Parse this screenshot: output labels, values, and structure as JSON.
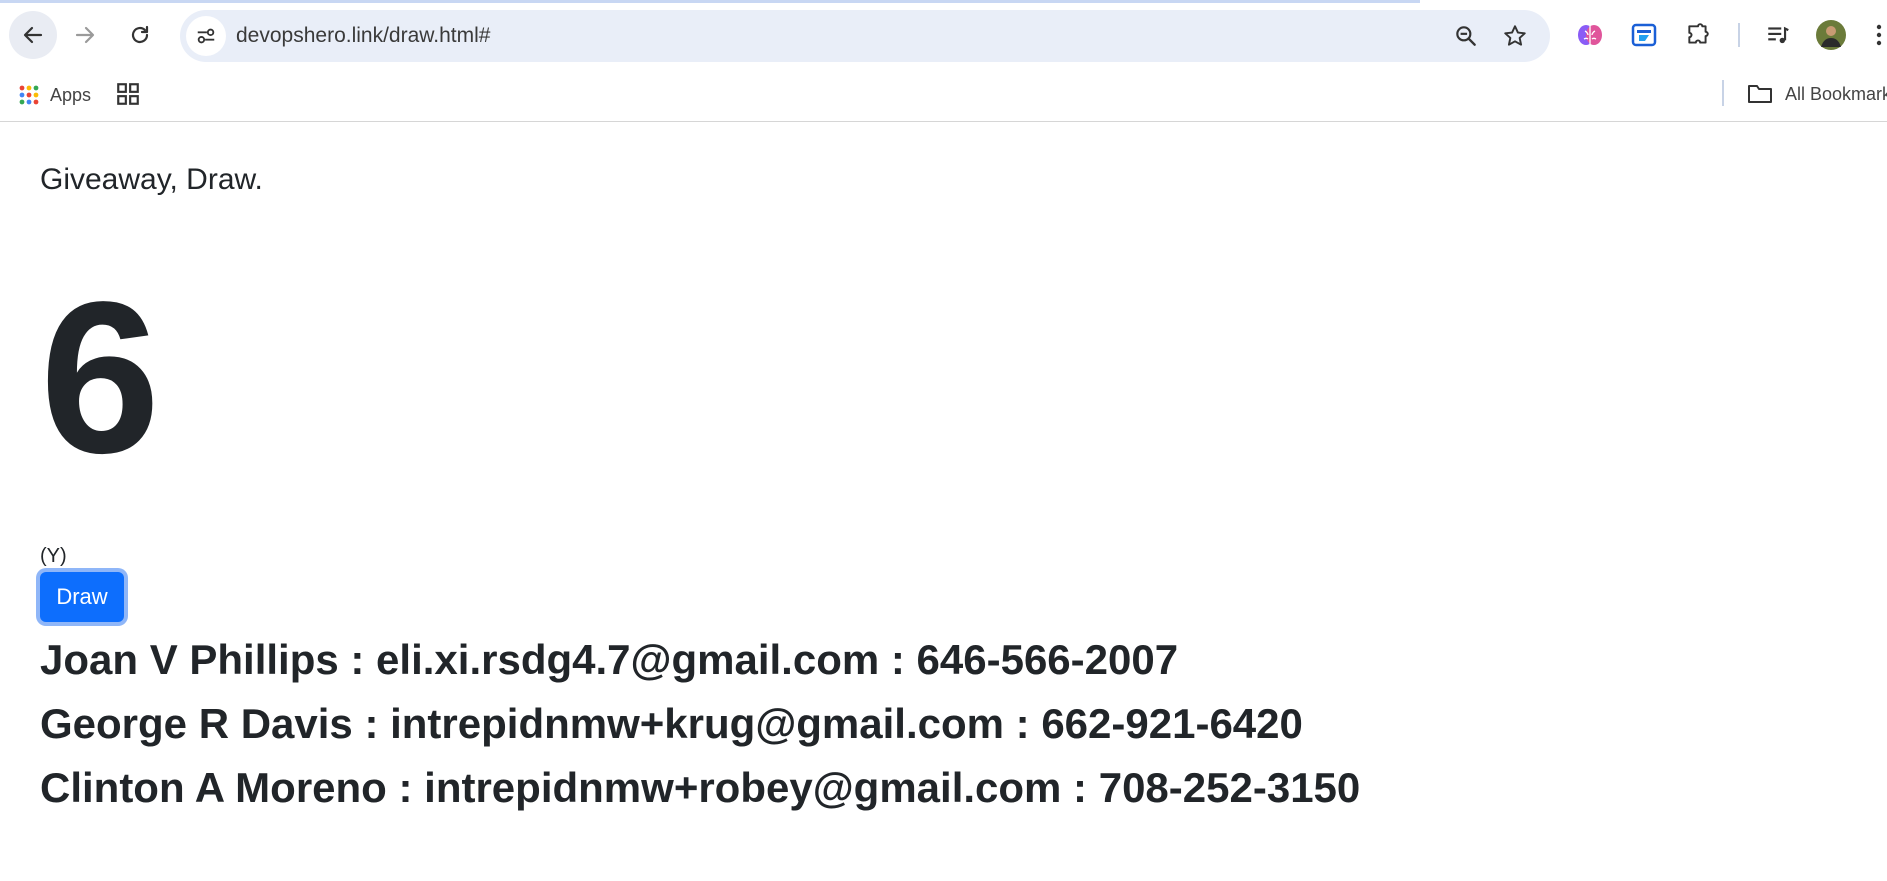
{
  "browser": {
    "url": "devopshero.link/draw.html#",
    "bookmarks": {
      "apps_label": "Apps",
      "all_bookmarks_label": "All Bookmarks"
    }
  },
  "page": {
    "subtitle": "Giveaway, Draw.",
    "drawn_count": "6",
    "y_label": "(Y)",
    "draw_button_label": "Draw",
    "winners": [
      "Joan V Phillips : eli.xi.rsdg4.7@gmail.com : 646-566-2007",
      "George R Davis : intrepidnmw+krug@gmail.com : 662-921-6420",
      "Clinton A Moreno : intrepidnmw+robey@gmail.com : 708-252-3150"
    ]
  },
  "colors": {
    "primary_button": "#0d6efd",
    "text": "#212529",
    "omnibox": "#e9eef8"
  },
  "icons": [
    "back-arrow-icon",
    "forward-arrow-icon",
    "reload-icon",
    "site-info-icon",
    "zoom-icon",
    "star-icon",
    "brain-extension-icon",
    "screen-extension-icon",
    "puzzle-extensions-icon",
    "media-queue-icon",
    "profile-avatar",
    "apps-grid-icon",
    "tab-groups-icon",
    "folder-icon"
  ]
}
